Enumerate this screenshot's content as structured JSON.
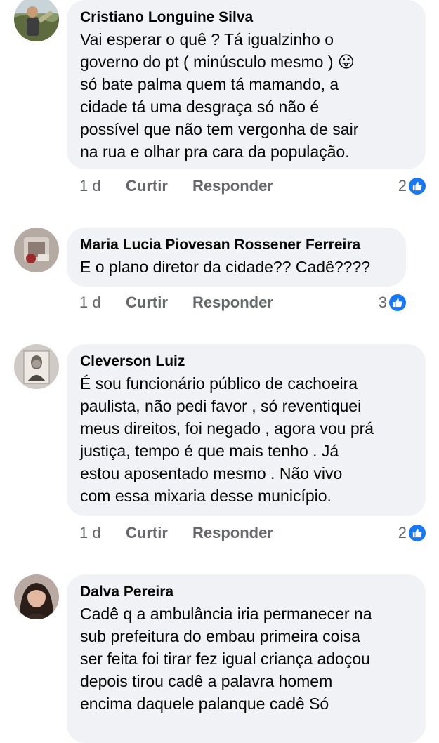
{
  "comments": [
    {
      "author": "Cristiano Longuine Silva",
      "text": "Vai esperar o quê ? Tá igualzinho o\ngoverno do pt ( minúsculo mesmo ) 😛\nsó bate palma quem tá mamando, a\ncidade tá uma desgraça só não é\npossível que não tem vergonha de sair\nna rua e olhar pra cara da população.",
      "time": "1 d",
      "like_label": "Curtir",
      "reply_label": "Responder",
      "reaction_count": "2"
    },
    {
      "author": "Maria Lucia Piovesan Rossener Ferreira",
      "text": "E o plano diretor da cidade?? Cadê????",
      "time": "1 d",
      "like_label": "Curtir",
      "reply_label": "Responder",
      "reaction_count": "3"
    },
    {
      "author": "Cleverson Luiz",
      "text": "É sou funcionário público de cachoeira\npaulista, não pedi favor , só reventiquei\nmeus direitos, foi negado , agora vou prá\njustiça, tempo é que mais tenho . Já\nestou aposentado mesmo . Não vivo\ncom essa mixaria desse município.",
      "time": "1 d",
      "like_label": "Curtir",
      "reply_label": "Responder",
      "reaction_count": "2"
    },
    {
      "author": "Dalva Pereira",
      "text": "Cadê q a ambulância iria permanecer na\nsub prefeitura do embau primeira coisa\nser feita foi tirar fez igual criança adoçou\ndepois tirou  cadê a palavra homem\nencima daquele palanque  cadê  Só",
      "time": "",
      "like_label": "",
      "reply_label": "",
      "reaction_count": ""
    }
  ],
  "icons": {
    "reaction": "like-thumb-icon",
    "reaction_color": "#1877f2"
  },
  "colors": {
    "bubble": "#f0f2f5",
    "meta_text": "#65676b",
    "text": "#050505"
  }
}
